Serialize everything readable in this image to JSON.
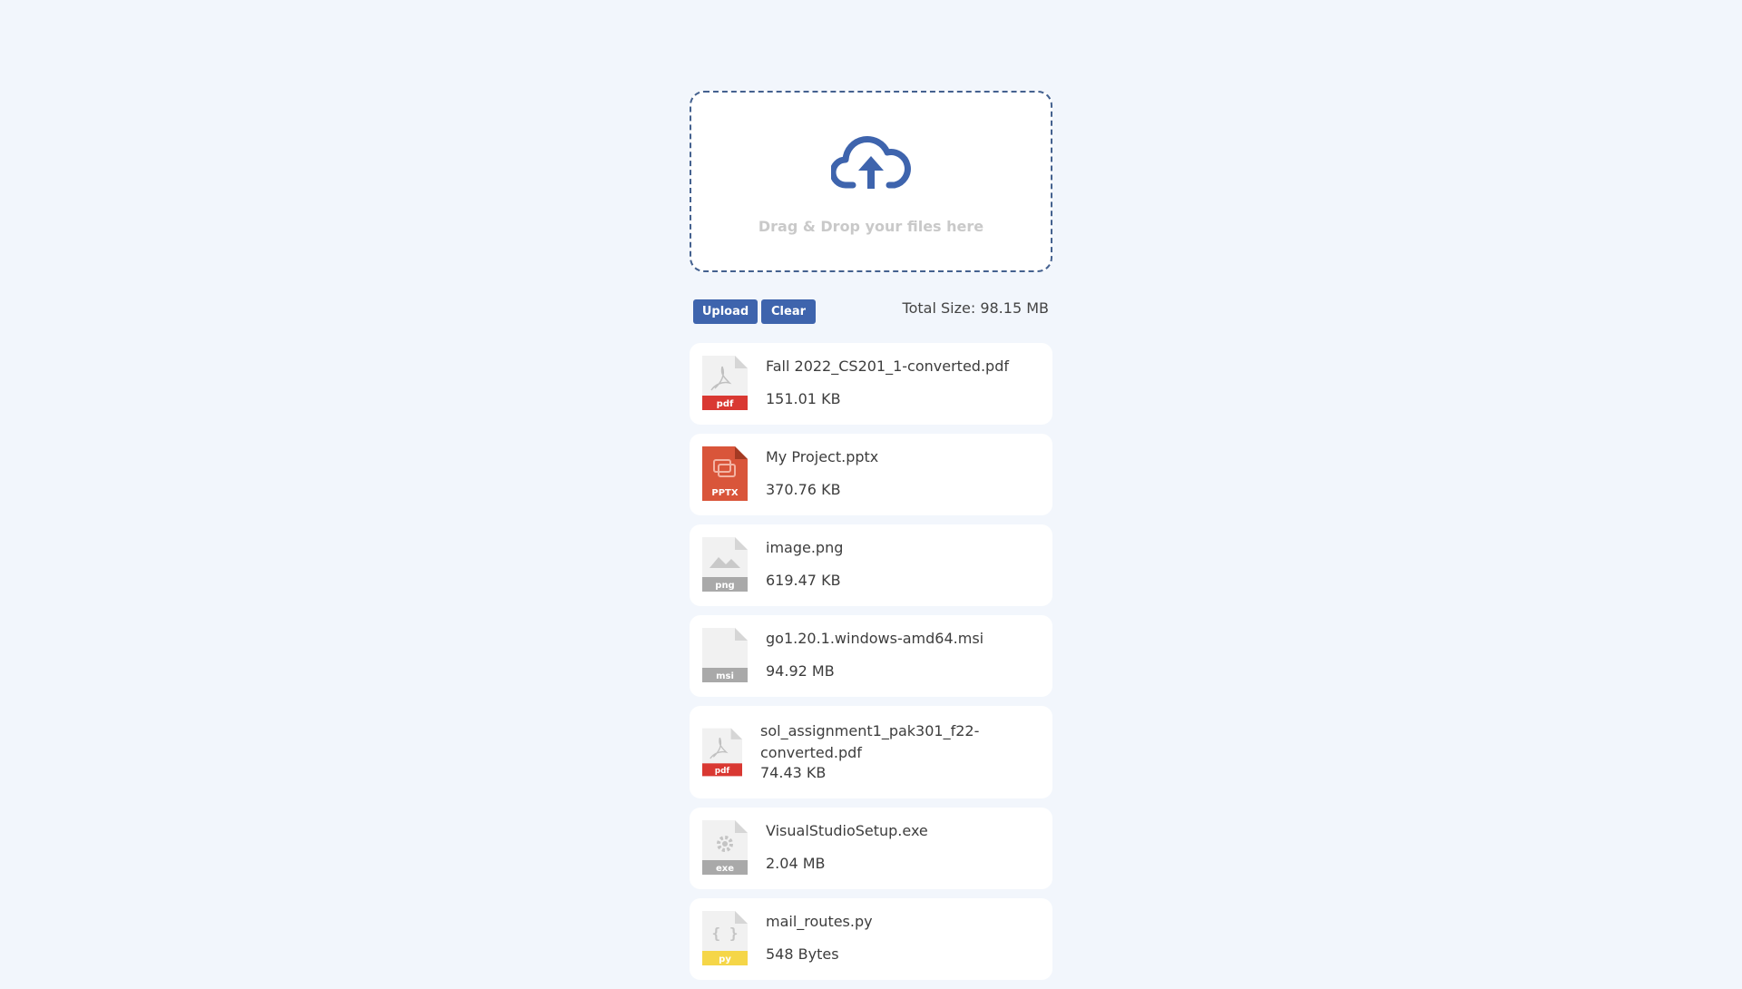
{
  "dropzone": {
    "hint": "Drag & Drop your files here",
    "icon": "cloud-upload-icon",
    "accent": "#3e64ad"
  },
  "toolbar": {
    "upload_label": "Upload",
    "clear_label": "Clear",
    "total_size": "Total Size: 98.15 MB"
  },
  "files": [
    {
      "name": "Fall 2022_CS201_1-converted.pdf",
      "size": "151.01 KB",
      "type": "pdf"
    },
    {
      "name": "My Project.pptx",
      "size": "370.76 KB",
      "type": "PPTX"
    },
    {
      "name": "image.png",
      "size": "619.47 KB",
      "type": "png"
    },
    {
      "name": "go1.20.1.windows-amd64.msi",
      "size": "94.92 MB",
      "type": "msi"
    },
    {
      "name": "sol_assignment1_pak301_f22-converted.pdf",
      "size": "74.43 KB",
      "type": "pdf"
    },
    {
      "name": "VisualStudioSetup.exe",
      "size": "2.04 MB",
      "type": "exe"
    },
    {
      "name": "mail_routes.py",
      "size": "548 Bytes",
      "type": "py"
    }
  ]
}
